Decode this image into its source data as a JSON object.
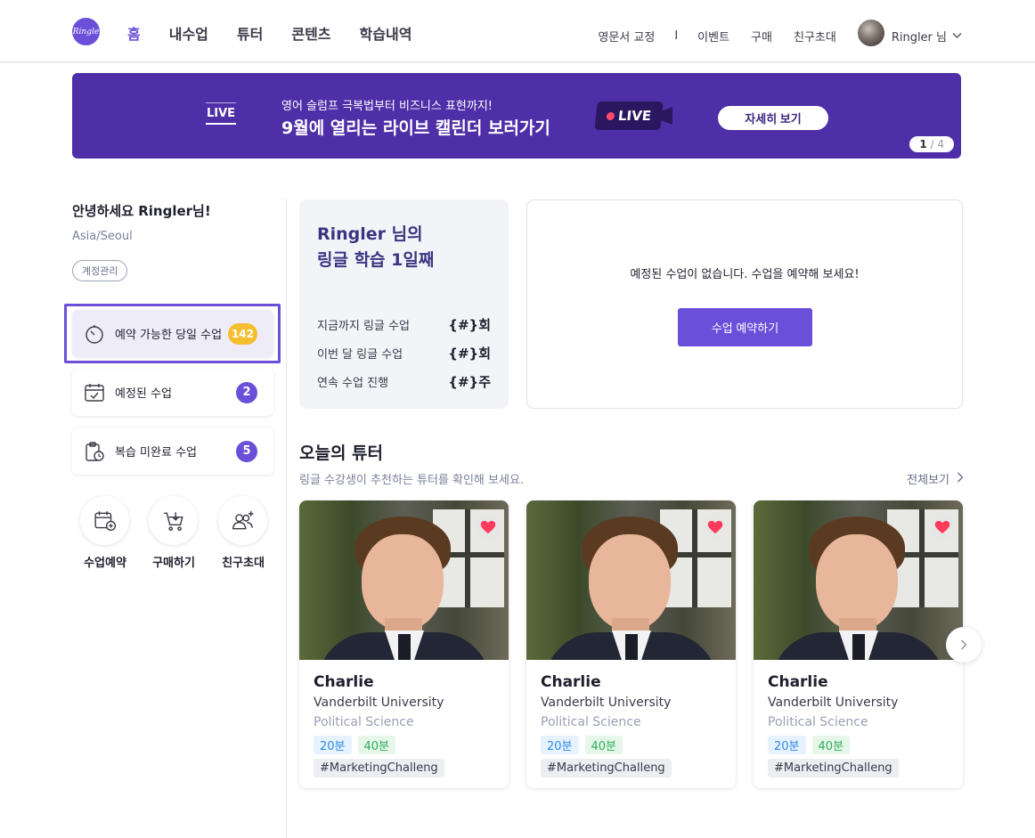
{
  "header": {
    "logo_text": "Ringle",
    "nav": [
      "홈",
      "내수업",
      "튜터",
      "콘텐츠",
      "학습내역"
    ],
    "right_links": [
      "영문서 교정",
      "이벤트",
      "구매",
      "친구초대"
    ],
    "separator": "I",
    "user_label": "Ringler 님"
  },
  "banner": {
    "tag": "LIVE",
    "subtitle": "영어 슬럼프 극복법부터 비즈니스 표현까지!",
    "title": "9월에 열리는 라이브 캘린더 보러가기",
    "camera_label": "LIVE",
    "button": "자세히 보기",
    "page_current": "1",
    "page_total": "/ 4"
  },
  "sidebar": {
    "greeting": "안녕하세요 Ringler님!",
    "timezone": "Asia/Seoul",
    "account_button": "계정관리",
    "menu": [
      {
        "label": "예약 가능한 당일 수업",
        "count": "142",
        "icon": "timer-icon"
      },
      {
        "label": "예정된 수업",
        "count": "2",
        "icon": "calendar-check-icon"
      },
      {
        "label": "복습 미완료 수업",
        "count": "5",
        "icon": "clipboard-clock-icon"
      }
    ],
    "quick": [
      {
        "label": "수업예약",
        "icon": "calendar-add-icon"
      },
      {
        "label": "구매하기",
        "icon": "cart-icon"
      },
      {
        "label": "친구초대",
        "icon": "invite-friends-icon"
      }
    ]
  },
  "stats": {
    "title_line1": "Ringler 님의",
    "title_line2": "링글 학습 1일째",
    "rows": [
      {
        "label": "지금까지 링글 수업",
        "value": "{#}회"
      },
      {
        "label": "이번 달 링글 수업",
        "value": "{#}회"
      },
      {
        "label": "연속 수업 진행",
        "value": "{#}주"
      }
    ]
  },
  "upcoming": {
    "message": "예정된 수업이 없습니다. 수업을 예약해 보세요!",
    "button": "수업 예약하기"
  },
  "tutors_section": {
    "title": "오늘의 튜터",
    "subtitle": "링글 수강생이 추천하는 튜터를 확인해 보세요.",
    "see_all": "전체보기",
    "tutors": [
      {
        "name": "Charlie",
        "university": "Vanderbilt University",
        "major": "Political Science",
        "tag1": "20분",
        "tag2": "40분",
        "hashtag": "#MarketingChalleng"
      },
      {
        "name": "Charlie",
        "university": "Vanderbilt University",
        "major": "Political Science",
        "tag1": "20분",
        "tag2": "40분",
        "hashtag": "#MarketingChalleng"
      },
      {
        "name": "Charlie",
        "university": "Vanderbilt University",
        "major": "Political Science",
        "tag1": "20분",
        "tag2": "40분",
        "hashtag": "#MarketingChalleng"
      }
    ]
  },
  "colors": {
    "brand": "#6a4fd9",
    "banner": "#4f2fa8",
    "badge_yellow": "#f5be2e",
    "heart": "#ff3b5c"
  }
}
